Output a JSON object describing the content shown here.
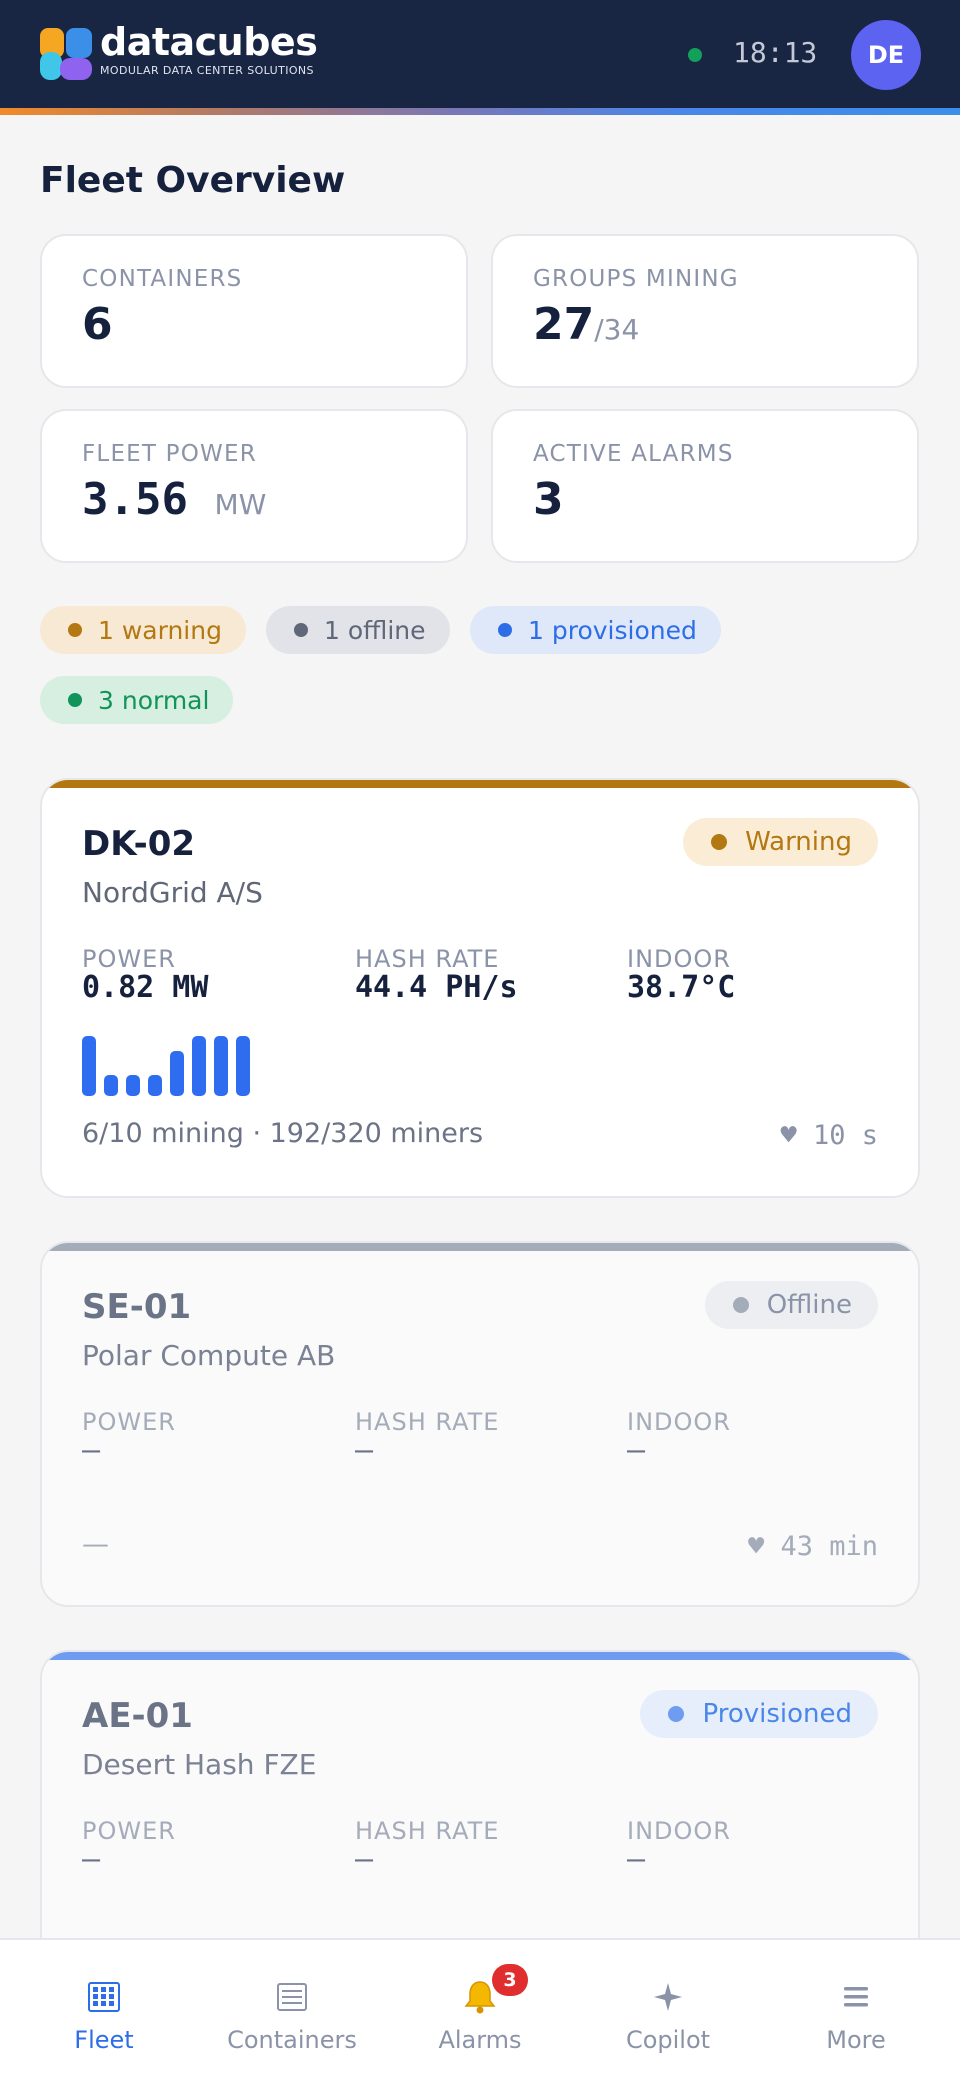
{
  "header": {
    "brand_name": "datacubes",
    "brand_tagline": "MODULAR DATA CENTER SOLUTIONS",
    "time": "18:13",
    "avatar_initials": "DE",
    "live_status_color": "#12a05a"
  },
  "page_title": "Fleet Overview",
  "stats": {
    "containers": {
      "label": "CONTAINERS",
      "value": "6"
    },
    "groups_mining": {
      "label": "GROUPS MINING",
      "value": "27",
      "total": "/34"
    },
    "fleet_power": {
      "label": "FLEET POWER",
      "value": "3.56",
      "unit": "MW"
    },
    "active_alarms": {
      "label": "ACTIVE ALARMS",
      "value": "3"
    }
  },
  "status_chips": {
    "warning": "1 warning",
    "offline": "1 offline",
    "provisioned": "1 provisioned",
    "normal": "3 normal"
  },
  "containers": [
    {
      "id": "DK-02",
      "owner": "NordGrid A/S",
      "status": "Warning",
      "status_color": "#b47812",
      "power_label": "POWER",
      "power": "0.82 MW",
      "hashrate_label": "HASH RATE",
      "hashrate": "44.4 PH/s",
      "indoor_label": "INDOOR",
      "indoor": "38.7°C",
      "group_levels": [
        1.0,
        0.35,
        0.35,
        0.35,
        0.75,
        1.0,
        1.0,
        1.0
      ],
      "summary": "6/10 mining · 192/320 miners",
      "heartbeat": "♥ 10 s"
    },
    {
      "id": "SE-01",
      "owner": "Polar Compute AB",
      "status": "Offline",
      "status_color": "#a4abb9",
      "power_label": "POWER",
      "power": "—",
      "hashrate_label": "HASH RATE",
      "hashrate": "—",
      "indoor_label": "INDOOR",
      "indoor": "—",
      "summary": "—",
      "heartbeat": "♥ 43 min"
    },
    {
      "id": "AE-01",
      "owner": "Desert Hash FZE",
      "status": "Provisioned",
      "status_color": "#6e9cf0",
      "power_label": "POWER",
      "power": "—",
      "hashrate_label": "HASH RATE",
      "hashrate": "—",
      "indoor_label": "INDOOR",
      "indoor": "—"
    }
  ],
  "tabbar": {
    "fleet": {
      "label": "Fleet",
      "icon": "grid-icon"
    },
    "containers": {
      "label": "Containers",
      "icon": "list-icon"
    },
    "alarms": {
      "label": "Alarms",
      "icon": "bell-icon",
      "badge": "3"
    },
    "copilot": {
      "label": "Copilot",
      "icon": "sparkle-icon"
    },
    "more": {
      "label": "More",
      "icon": "menu-icon"
    }
  }
}
